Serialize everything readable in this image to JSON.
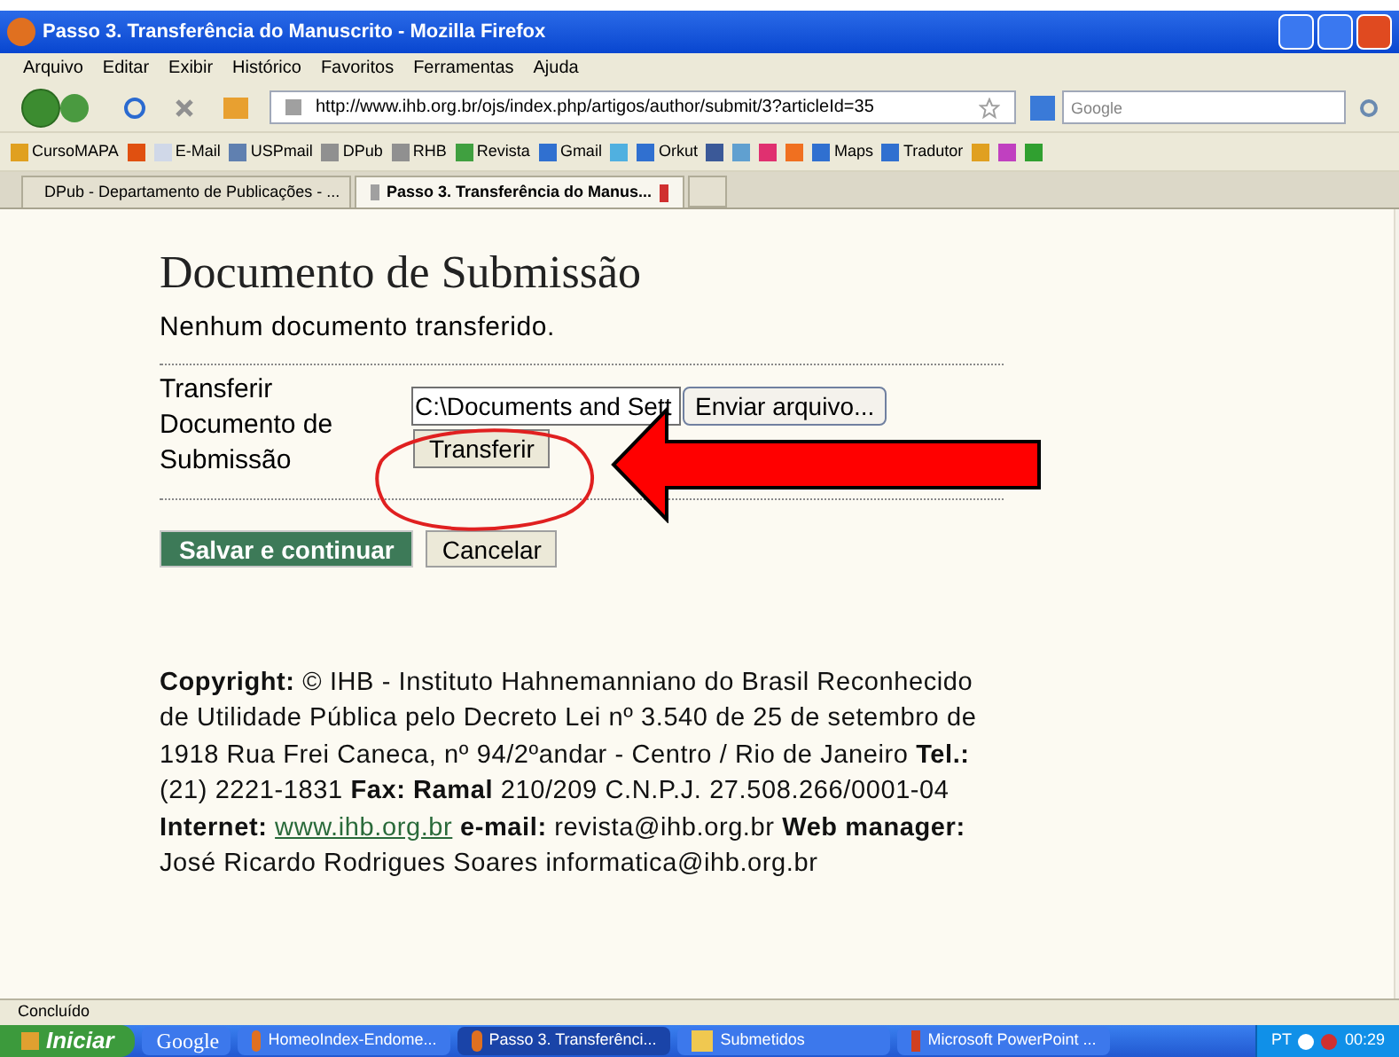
{
  "window": {
    "title": "Passo 3. Transferência do Manuscrito - Mozilla Firefox"
  },
  "menu": [
    "Arquivo",
    "Editar",
    "Exibir",
    "Histórico",
    "Favoritos",
    "Ferramentas",
    "Ajuda"
  ],
  "address": {
    "value": "http://www.ihb.org.br/ojs/index.php/artigos/author/submit/3?articleId=35"
  },
  "search": {
    "placeholder": "Google"
  },
  "bookmarks": [
    {
      "label": "CursoMAPA",
      "color": "#e0a020"
    },
    {
      "color": "#e05010"
    },
    {
      "label": "E-Mail",
      "color": "#d0d8e8"
    },
    {
      "label": "USPmail",
      "color": "#6080b0"
    },
    {
      "label": "DPub",
      "color": "#909090"
    },
    {
      "label": "RHB",
      "color": "#909090"
    },
    {
      "label": "Revista",
      "color": "#40a040"
    },
    {
      "label": "Gmail",
      "color": "#3070d0"
    },
    {
      "color": "#50b0e0"
    },
    {
      "label": "Orkut",
      "color": "#3070d0"
    },
    {
      "color": "#3b5998"
    },
    {
      "color": "#60a0d0"
    },
    {
      "color": "#e03070"
    },
    {
      "color": "#f07020"
    },
    {
      "label": "Maps",
      "color": "#3070d0"
    },
    {
      "label": "Tradutor",
      "color": "#3070d0"
    },
    {
      "color": "#e0a020"
    },
    {
      "color": "#c040c0"
    },
    {
      "color": "#30a030"
    }
  ],
  "tabs": [
    {
      "label": "DPub - Departamento de Publicações - ...",
      "selected": false
    },
    {
      "label": "Passo 3. Transferência do Manus...",
      "selected": true
    }
  ],
  "page": {
    "heading": "Documento de Submissão",
    "status": "Nenhum documento transferido.",
    "upload_label": "Transferir Documento de Submissão",
    "file_value": "C:\\Documents and Sett",
    "browse_button": "Enviar arquivo...",
    "upload_button": "Transferir",
    "save_button": "Salvar e continuar",
    "cancel_button": "Cancelar",
    "footer_before_link": "**Copyright:** © IHB - Instituto Hahnemanniano do Brasil Reconhecido de Utilidade Pública pelo Decreto Lei nº 3.540 de 25 de setembro de 1918 Rua Frei Caneca, nº 94/2ºandar - Centro / Rio de Janeiro **Tel.:** (21) 2221-1831 **Fax: Ramal** 210/209 C.N.P.J. 27.508.266/0001-04 **Internet:**",
    "footer_link": "www.ihb.org.br",
    "footer_after_link": "**e-mail:** revista@ihb.org.br **Web manager:** José Ricardo Rodrigues Soares informatica@ihb.org.br"
  },
  "status_bar": "Concluído",
  "taskbar": {
    "start": "Iniciar",
    "items": [
      {
        "label": "Google",
        "kind": "toolbar",
        "selected": false
      },
      {
        "label": "HomeoIndex-Endome...",
        "kind": "firefox",
        "selected": false
      },
      {
        "label": "Passo 3. Transferênci...",
        "kind": "firefox",
        "selected": true
      },
      {
        "label": "Submetidos",
        "kind": "folder",
        "selected": false
      },
      {
        "label": "Microsoft PowerPoint ...",
        "kind": "powerpoint",
        "selected": false
      }
    ],
    "language": "PT",
    "clock": "00:29"
  }
}
